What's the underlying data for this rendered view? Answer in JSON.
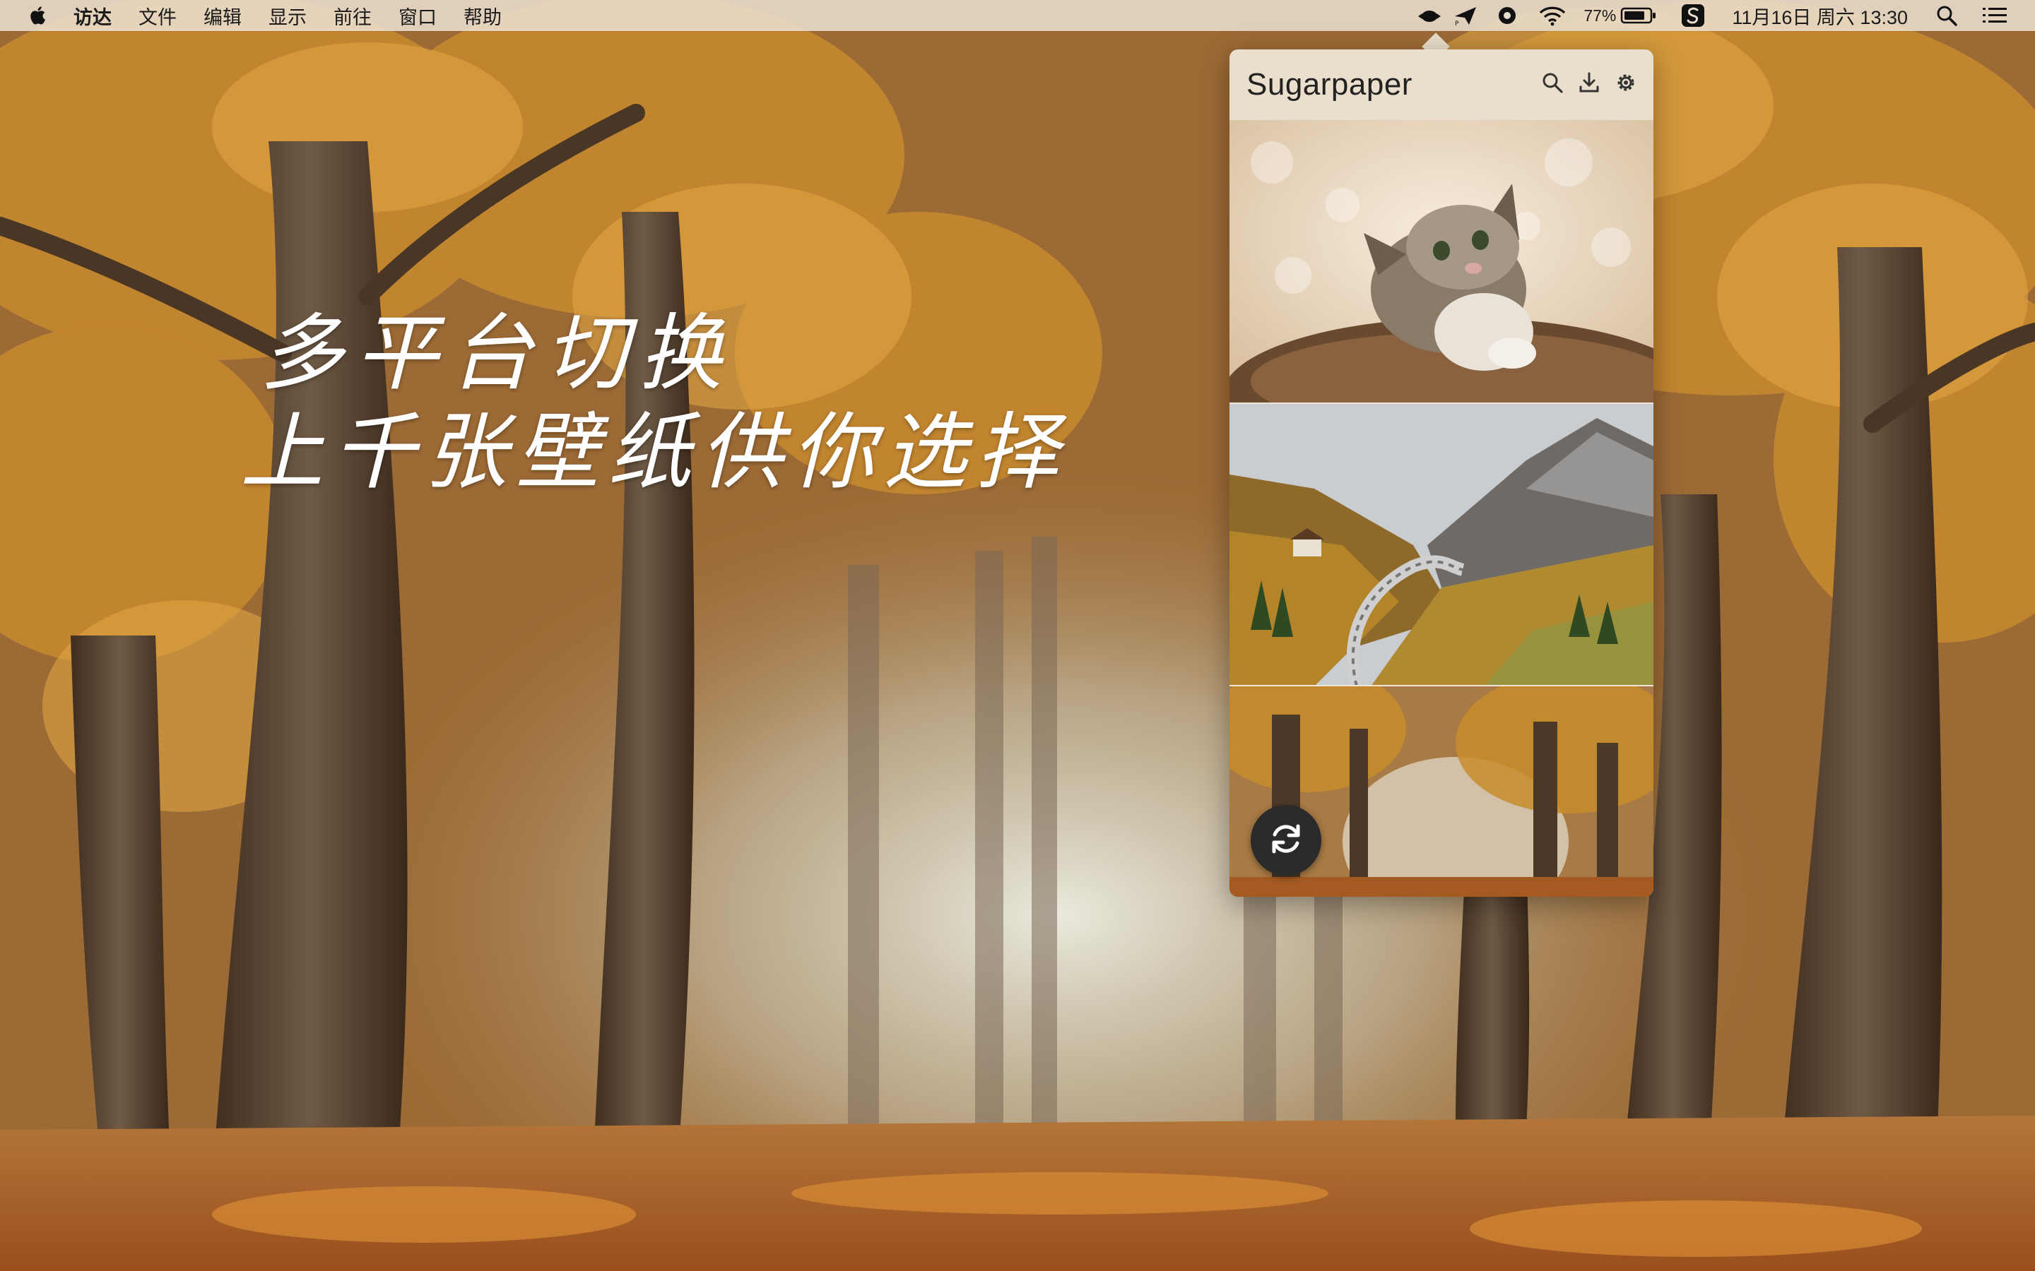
{
  "menubar": {
    "apple_icon": "apple-logo-icon",
    "items": [
      {
        "label": "访达",
        "bold": true
      },
      {
        "label": "文件"
      },
      {
        "label": "编辑"
      },
      {
        "label": "显示"
      },
      {
        "label": "前往"
      },
      {
        "label": "窗口"
      },
      {
        "label": "帮助"
      }
    ],
    "status": {
      "battery_percent": "77%",
      "clock": "11月16日 周六 13:30",
      "icons": [
        "cloud-service-icon",
        "paper-plane-icon",
        "record-icon",
        "wifi-icon",
        "battery-icon",
        "sugarpaper-app-icon",
        "search-icon",
        "list-icon"
      ]
    }
  },
  "slogan": {
    "line1": "多平台切换",
    "line2": "上千张壁纸供你选择"
  },
  "popover": {
    "title": "Sugarpaper",
    "actions": [
      "search-icon",
      "download-icon",
      "gear-icon"
    ],
    "wallpapers": [
      {
        "subject": "kitten"
      },
      {
        "subject": "mountain-road"
      },
      {
        "subject": "autumn-forest"
      }
    ],
    "refresh_icon": "refresh-icon"
  },
  "colors": {
    "menubar_bg": "#e9dece",
    "popover_bg": "#eadfcc",
    "refresh_bg": "#2b2b2b",
    "slogan": "#ffffff"
  }
}
